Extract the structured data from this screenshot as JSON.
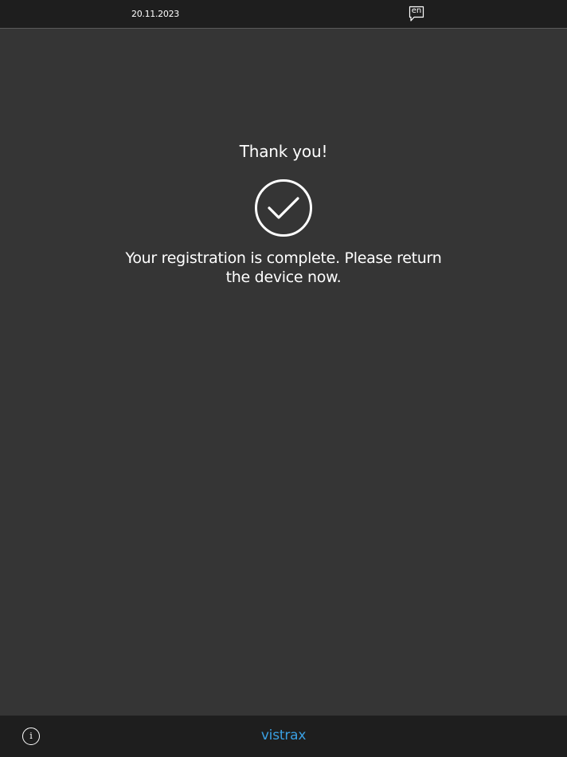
{
  "header": {
    "date": "20.11.2023",
    "language": "en",
    "language_icon": "speech-bubble-icon"
  },
  "main": {
    "title": "Thank you!",
    "status_icon": "checkmark-circle-icon",
    "message": "Your registration is complete. Please return the device now."
  },
  "footer": {
    "info_icon": "info-icon",
    "info_glyph": "i",
    "brand": "vistrax"
  },
  "colors": {
    "background": "#353535",
    "bar": "#1e1e1e",
    "brand": "#3aa0e3",
    "text": "#ffffff"
  }
}
